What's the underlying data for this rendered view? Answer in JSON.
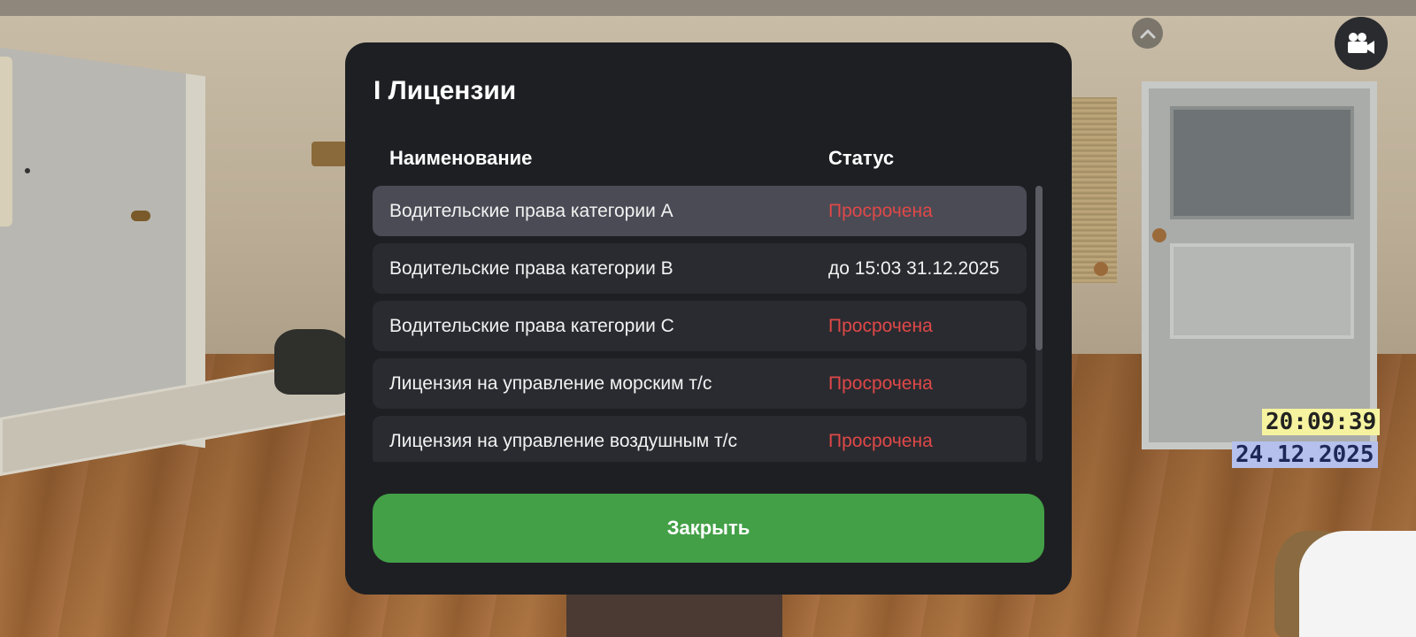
{
  "modal": {
    "title": "I Лицензии",
    "columns": {
      "name": "Наименование",
      "status": "Статус"
    },
    "rows": [
      {
        "name": "Водительские права категории A",
        "status": "Просрочена",
        "status_color": "#e04848",
        "selected": true
      },
      {
        "name": "Водительские права категории B",
        "status": "до 15:03 31.12.2025",
        "status_color": "#f2f2f2",
        "selected": false
      },
      {
        "name": "Водительские права категории C",
        "status": "Просрочена",
        "status_color": "#e04848",
        "selected": false
      },
      {
        "name": "Лицензия на управление морским т/с",
        "status": "Просрочена",
        "status_color": "#e04848",
        "selected": false
      },
      {
        "name": "Лицензия на управление воздушным т/с",
        "status": "Просрочена",
        "status_color": "#e04848",
        "selected": false
      }
    ],
    "close_label": "Закрыть",
    "close_color": "#43a047"
  },
  "hud": {
    "time": "20:09:39",
    "date": "24.12.2025",
    "camera_icon": "video-camera-icon",
    "up_icon": "chevron-up-icon"
  }
}
